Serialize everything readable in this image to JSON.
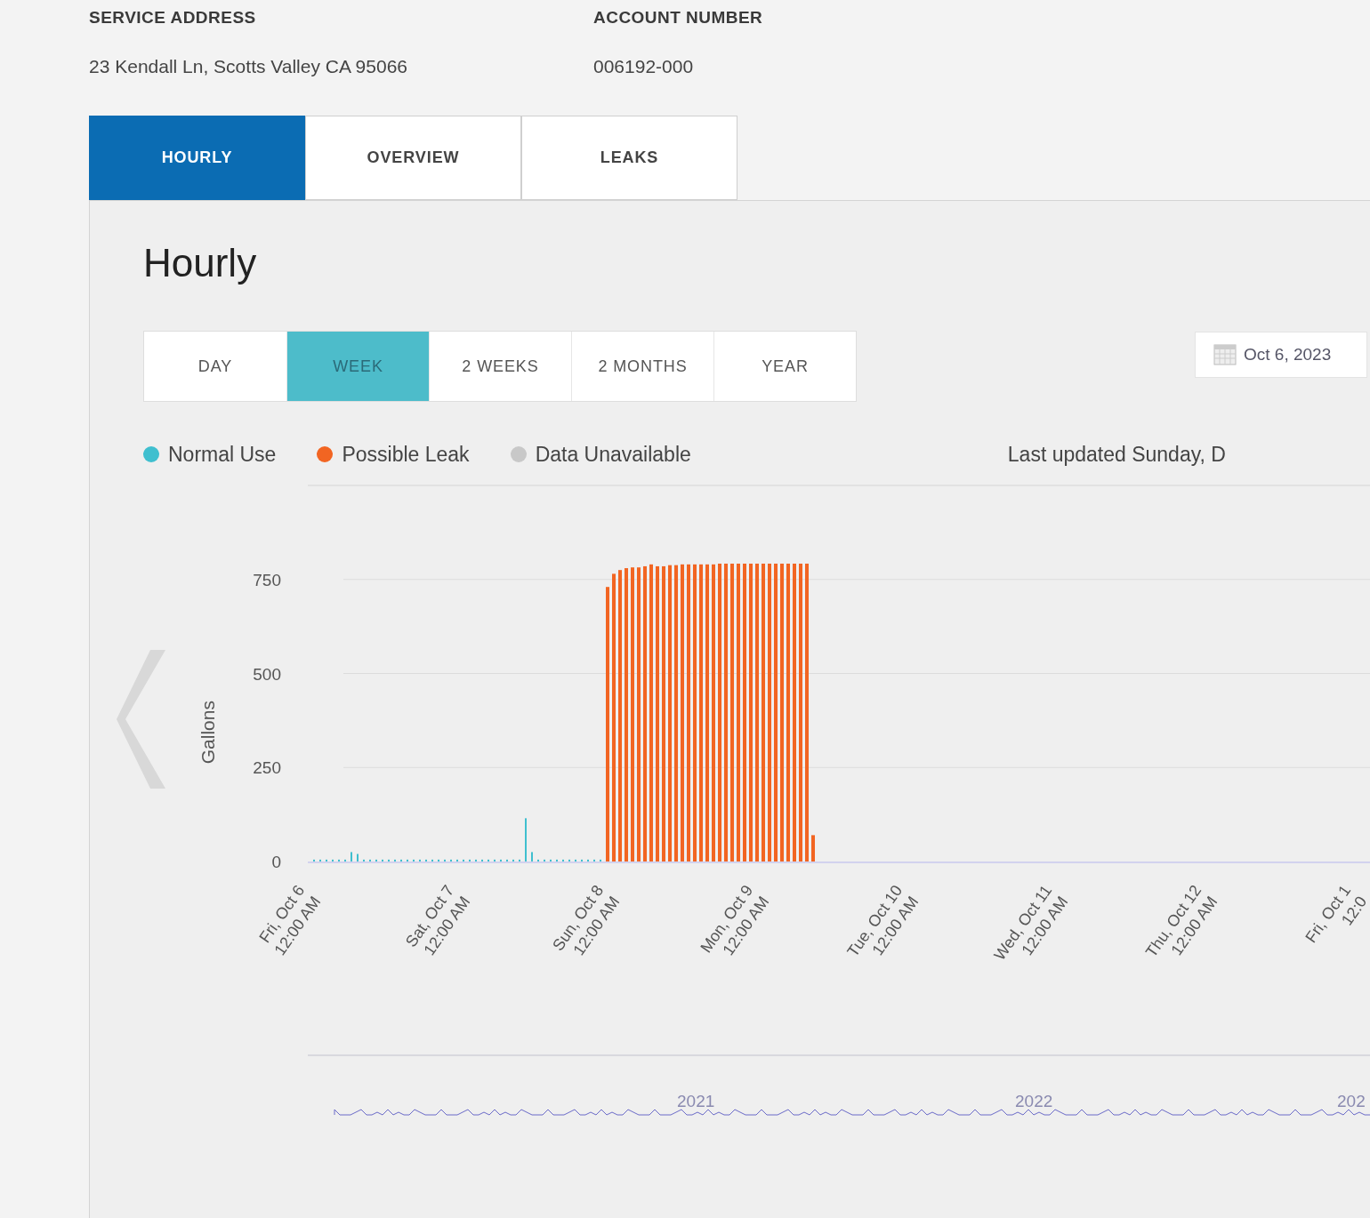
{
  "service_address": {
    "label": "SERVICE ADDRESS",
    "value": "23 Kendall Ln, Scotts Valley CA 95066"
  },
  "account_number": {
    "label": "ACCOUNT NUMBER",
    "value": "006192-000"
  },
  "tabs": [
    {
      "label": "HOURLY",
      "selected": true
    },
    {
      "label": "OVERVIEW",
      "selected": false
    },
    {
      "label": "LEAKS",
      "selected": false
    }
  ],
  "panel": {
    "title": "Hourly",
    "ranges": [
      {
        "label": "DAY",
        "selected": false
      },
      {
        "label": "WEEK",
        "selected": true
      },
      {
        "label": "2 WEEKS",
        "selected": false
      },
      {
        "label": "2 MONTHS",
        "selected": false
      },
      {
        "label": "YEAR",
        "selected": false
      }
    ],
    "date": "Oct 6, 2023",
    "extra_legend": [
      {
        "label": "Data Unavailable",
        "color": "#c8c8c8"
      }
    ],
    "last_updated": "Last updated Sunday, D",
    "chart_data": {
      "type": "bar",
      "ylabel": "Gallons",
      "grid": true,
      "ylim": [
        0,
        1000
      ],
      "yticks": [
        0,
        250,
        500,
        750
      ],
      "categories": [
        "Fri, Oct 6\n12:00 AM",
        null,
        null,
        null,
        null,
        null,
        null,
        null,
        null,
        null,
        null,
        null,
        null,
        null,
        null,
        null,
        null,
        null,
        null,
        null,
        null,
        null,
        null,
        null,
        "Sat, Oct 7\n12:00 AM",
        null,
        null,
        null,
        null,
        null,
        null,
        null,
        null,
        null,
        null,
        null,
        null,
        null,
        null,
        null,
        null,
        null,
        null,
        null,
        null,
        null,
        null,
        null,
        "Sun, Oct 8\n12:00 AM",
        null,
        null,
        null,
        null,
        null,
        null,
        null,
        null,
        null,
        null,
        null,
        null,
        null,
        null,
        null,
        null,
        null,
        null,
        null,
        null,
        null,
        null,
        null,
        "Mon, Oct 9\n12:00 AM",
        null,
        null,
        null,
        null,
        null,
        null,
        null,
        null,
        null,
        null,
        null,
        null,
        null,
        null,
        null,
        null,
        null,
        null,
        null,
        null,
        null,
        null,
        null,
        "Tue, Oct 10\n12:00 AM",
        null,
        null,
        null,
        null,
        null,
        null,
        null,
        null,
        null,
        null,
        null,
        null,
        null,
        null,
        null,
        null,
        null,
        null,
        null,
        null,
        null,
        null,
        null,
        "Wed, Oct 11\n12:00 AM",
        null,
        null,
        null,
        null,
        null,
        null,
        null,
        null,
        null,
        null,
        null,
        null,
        null,
        null,
        null,
        null,
        null,
        null,
        null,
        null,
        null,
        null,
        null,
        "Thu, Oct 12\n12:00 AM",
        null,
        null,
        null,
        null,
        null,
        null,
        null,
        null,
        null,
        null,
        null,
        null,
        null,
        null,
        null,
        null,
        null,
        null,
        null,
        null,
        null,
        null,
        null,
        "Fri, Oct 1\n12:0",
        null
      ],
      "series": [
        {
          "name": "Normal Use",
          "color": "#3fbfcf",
          "values": [
            5,
            5,
            5,
            5,
            5,
            5,
            25,
            20,
            5,
            5,
            5,
            5,
            5,
            5,
            5,
            5,
            5,
            5,
            5,
            5,
            5,
            5,
            5,
            5,
            5,
            5,
            5,
            5,
            5,
            5,
            5,
            5,
            5,
            5,
            115,
            25,
            5,
            5,
            5,
            5,
            5,
            5,
            5,
            5,
            5,
            5,
            5,
            null,
            null,
            null,
            null,
            null,
            null,
            null,
            null,
            null,
            null,
            null,
            null,
            null,
            null,
            null,
            null,
            null,
            null,
            null,
            null,
            null,
            null,
            null,
            null,
            null,
            null,
            null,
            null,
            null,
            null,
            null,
            null,
            null,
            null,
            null,
            null,
            null,
            null,
            null,
            null,
            null,
            null,
            null,
            null,
            null,
            null,
            null,
            null,
            null,
            null,
            null,
            null,
            null,
            null,
            null,
            null,
            null,
            null,
            null,
            null,
            null,
            null,
            null,
            null,
            null,
            null,
            null,
            null,
            null,
            null,
            null,
            null,
            null,
            null,
            null,
            null,
            null,
            null,
            null,
            null,
            null,
            null,
            null,
            null,
            null,
            null,
            null,
            null,
            null,
            null,
            null,
            null,
            null,
            null,
            null,
            null,
            null,
            null,
            null,
            null,
            null,
            null,
            null,
            null,
            null,
            null,
            null,
            null,
            null,
            null,
            null,
            null,
            null,
            null,
            null,
            null,
            null,
            null,
            null,
            null,
            null,
            null,
            null
          ]
        },
        {
          "name": "Possible Leak",
          "color": "#f26522",
          "values": [
            null,
            null,
            null,
            null,
            null,
            null,
            null,
            null,
            null,
            null,
            null,
            null,
            null,
            null,
            null,
            null,
            null,
            null,
            null,
            null,
            null,
            null,
            null,
            null,
            null,
            null,
            null,
            null,
            null,
            null,
            null,
            null,
            null,
            null,
            null,
            null,
            null,
            null,
            null,
            null,
            null,
            null,
            null,
            null,
            null,
            null,
            null,
            730,
            765,
            775,
            780,
            782,
            782,
            785,
            790,
            785,
            785,
            788,
            788,
            790,
            790,
            790,
            790,
            790,
            790,
            792,
            792,
            792,
            792,
            792,
            792,
            792,
            792,
            792,
            792,
            792,
            792,
            792,
            792,
            792,
            70,
            null,
            null,
            null,
            null,
            null,
            null,
            null,
            null,
            null,
            null,
            null,
            null,
            null,
            null,
            null,
            null,
            null,
            null,
            null,
            null,
            null,
            null,
            null,
            null,
            null,
            null,
            null,
            null,
            null,
            null,
            null,
            null,
            null,
            null,
            null,
            null,
            null,
            null,
            null,
            null,
            null,
            null,
            null,
            null,
            null,
            null,
            null,
            null,
            null,
            null,
            null,
            null,
            null,
            null,
            null,
            null,
            null,
            null,
            null,
            null,
            null,
            null,
            null,
            null,
            null,
            null,
            null,
            null,
            null,
            null,
            null,
            null,
            null,
            null,
            null,
            null,
            null,
            null,
            null,
            null,
            null,
            null,
            null,
            null,
            null,
            null,
            null,
            null,
            null
          ]
        }
      ]
    },
    "navigator": {
      "years": [
        "2021",
        "2022",
        "202"
      ]
    }
  }
}
